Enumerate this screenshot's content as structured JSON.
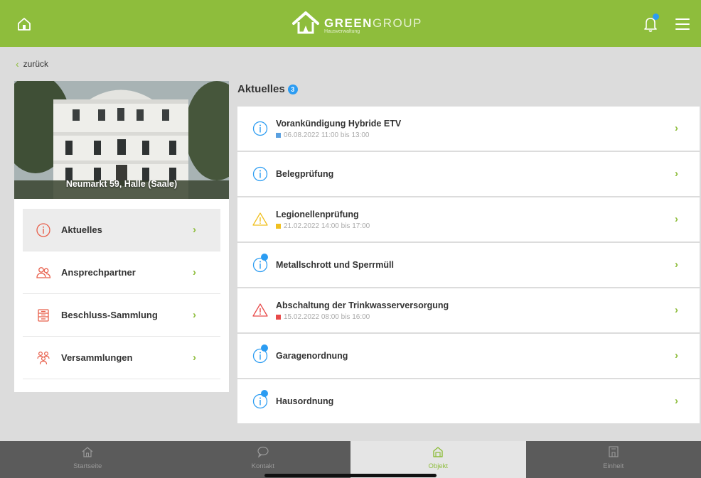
{
  "header": {
    "brand_bold": "GREEN",
    "brand_light": "GROUP",
    "brand_sub": "Hausverwaltung",
    "accent": "#8ebd3c",
    "notification_color": "#2b9cf2"
  },
  "nav": {
    "back_label": "zurück"
  },
  "property": {
    "address": "Neumarkt 59, Halle (Saale)"
  },
  "menu": [
    {
      "label": "Aktuelles",
      "icon": "info-icon",
      "active": true
    },
    {
      "label": "Ansprechpartner",
      "icon": "people-icon",
      "active": false
    },
    {
      "label": "Beschluss-Sammlung",
      "icon": "archive-icon",
      "active": false
    },
    {
      "label": "Versammlungen",
      "icon": "group-icon",
      "active": false
    }
  ],
  "news": {
    "title": "Aktuelles",
    "badge": "3",
    "items": [
      {
        "title": "Vorankündigung Hybride ETV",
        "date": "06.08.2022 11:00 bis 13:00",
        "icon": "info-icon",
        "unread": false,
        "date_color": "#5aa0e0"
      },
      {
        "title": "Belegprüfung",
        "date": "",
        "icon": "info-icon",
        "unread": false
      },
      {
        "title": "Legionellenprüfung",
        "date": "21.02.2022 14:00 bis 17:00",
        "icon": "warning-icon",
        "unread": false,
        "date_color": "#f0c020"
      },
      {
        "title": "Metallschrott und Sperrmüll",
        "date": "",
        "icon": "info-icon",
        "unread": true
      },
      {
        "title": "Abschaltung der Trinkwasserversorgung",
        "date": "15.02.2022 08:00 bis 16:00",
        "icon": "alert-icon",
        "unread": false,
        "date_color": "#e84a4a"
      },
      {
        "title": "Garagenordnung",
        "date": "",
        "icon": "info-icon",
        "unread": true
      },
      {
        "title": "Hausordnung",
        "date": "",
        "icon": "info-icon",
        "unread": true
      }
    ]
  },
  "tabs": [
    {
      "label": "Startseite",
      "icon": "home-icon",
      "active": false
    },
    {
      "label": "Kontakt",
      "icon": "chat-icon",
      "active": false
    },
    {
      "label": "Objekt",
      "icon": "building-icon",
      "active": true
    },
    {
      "label": "Einheit",
      "icon": "unit-icon",
      "active": false
    }
  ]
}
